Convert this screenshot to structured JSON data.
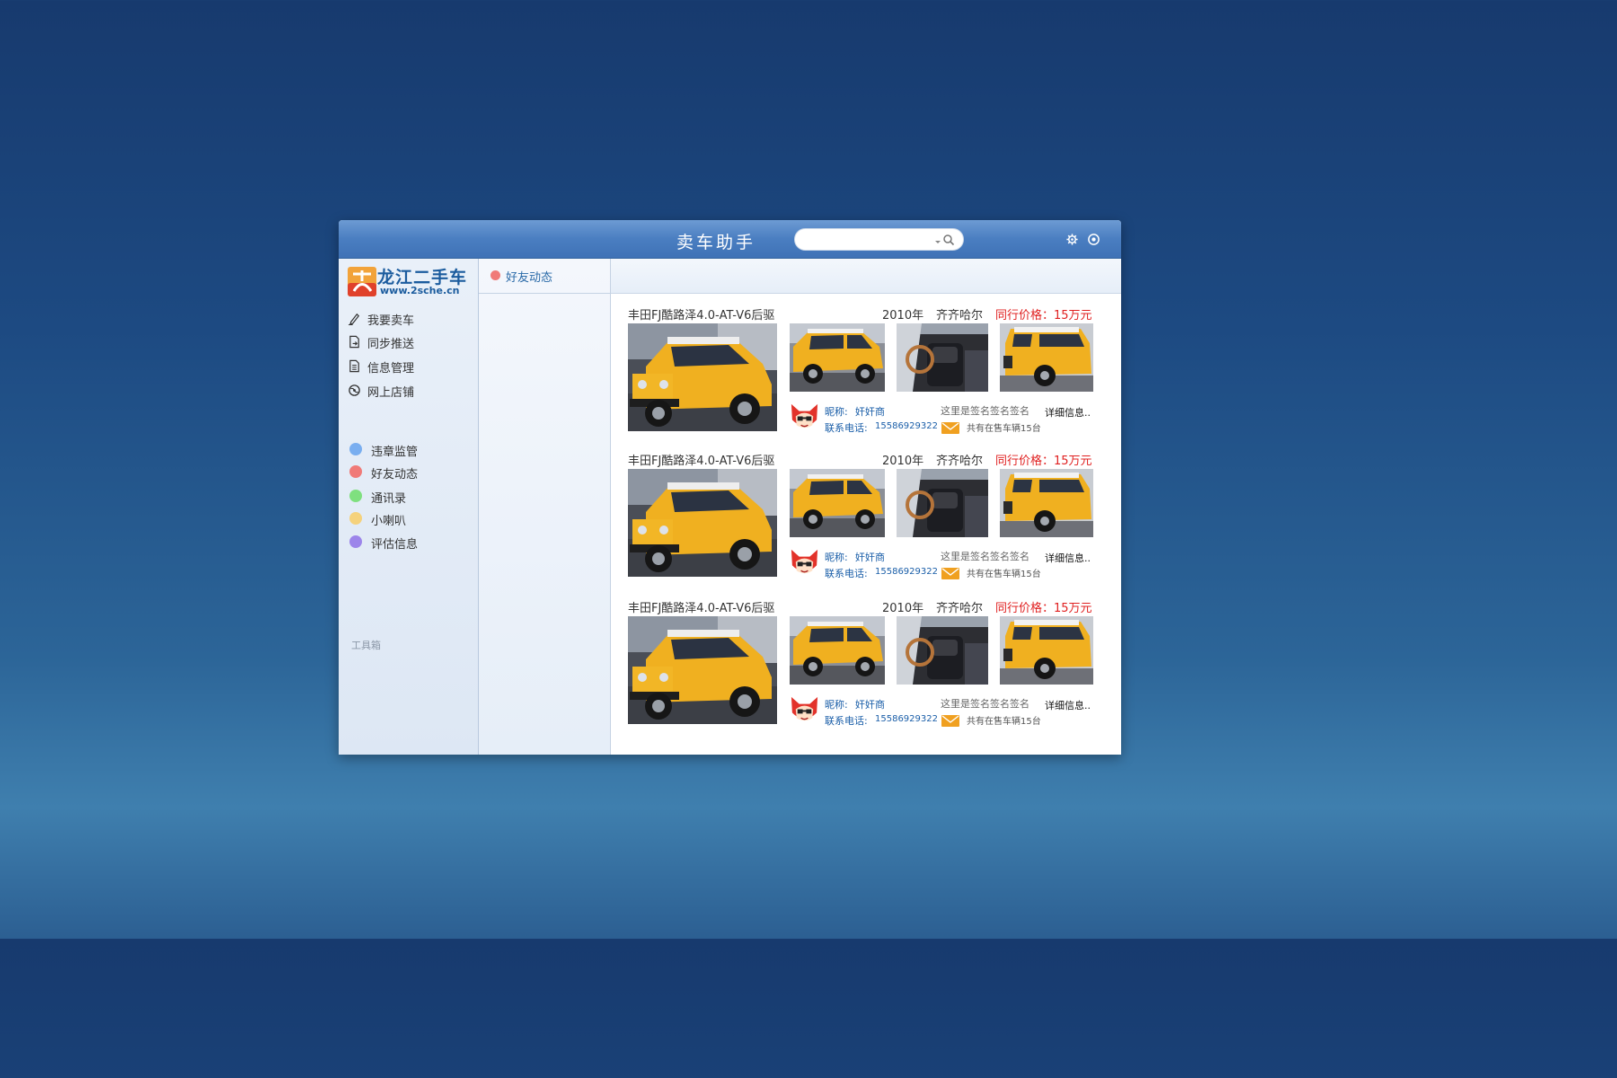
{
  "window": {
    "title": "卖车助手"
  },
  "search": {
    "placeholder": "",
    "value": ""
  },
  "colors": {
    "titlebar": "#4a7ec1",
    "brand": "#1b5c9e",
    "price": "#e02020",
    "link": "#1a5ea8"
  },
  "logo": {
    "name_cn": "龙江二手车",
    "url": "www.2sche.cn"
  },
  "sidebar": {
    "menu": [
      {
        "label": "我要卖车",
        "icon": "pencil-icon"
      },
      {
        "label": "同步推送",
        "icon": "sync-push-icon"
      },
      {
        "label": "信息管理",
        "icon": "document-icon"
      },
      {
        "label": "网上店铺",
        "icon": "globe-icon"
      }
    ],
    "toolbox_label": "工具箱",
    "tools": [
      {
        "label": "违章监管",
        "color": "#79aef0"
      },
      {
        "label": "好友动态",
        "color": "#f07a78"
      },
      {
        "label": "通讯录",
        "color": "#7fe07f"
      },
      {
        "label": "小喇叭",
        "color": "#f5d27c"
      },
      {
        "label": "评估信息",
        "color": "#9c85ea"
      }
    ]
  },
  "panel": {
    "active_tab": "好友动态",
    "tab_color": "#f07a78"
  },
  "listings": [
    {
      "title": "丰田FJ酷路泽4.0-AT-V6后驱",
      "year": "2010年",
      "city": "齐齐哈尔",
      "price": "同行价格：15万元",
      "nickname_label": "昵称:",
      "nickname": "奸奸商",
      "signature": "这里是签名签名签名",
      "detail": "详细信息..",
      "phone_label": "联系电话:",
      "phone": "15586929322",
      "on_sale": "共有在售车辆15台"
    },
    {
      "title": "丰田FJ酷路泽4.0-AT-V6后驱",
      "year": "2010年",
      "city": "齐齐哈尔",
      "price": "同行价格：15万元",
      "nickname_label": "昵称:",
      "nickname": "奸奸商",
      "signature": "这里是签名签名签名",
      "detail": "详细信息..",
      "phone_label": "联系电话:",
      "phone": "15586929322",
      "on_sale": "共有在售车辆15台"
    },
    {
      "title": "丰田FJ酷路泽4.0-AT-V6后驱",
      "year": "2010年",
      "city": "齐齐哈尔",
      "price": "同行价格：15万元",
      "nickname_label": "昵称:",
      "nickname": "奸奸商",
      "signature": "这里是签名签名签名",
      "detail": "详细信息..",
      "phone_label": "联系电话:",
      "phone": "15586929322",
      "on_sale": "共有在售车辆15台"
    }
  ]
}
